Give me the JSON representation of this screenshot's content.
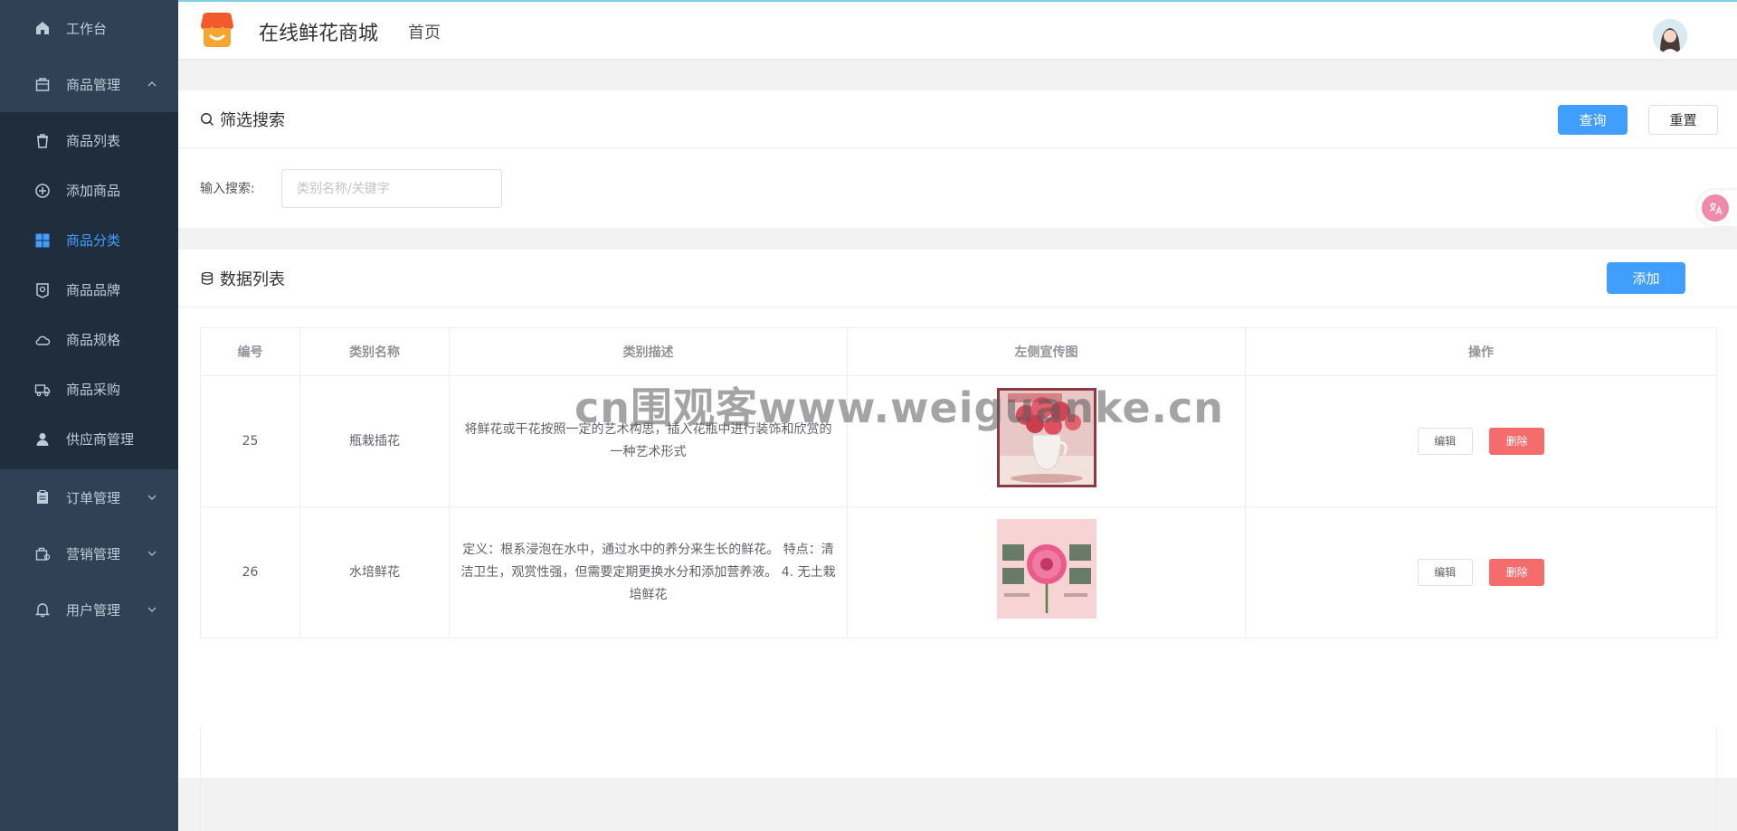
{
  "header": {
    "brand": "在线鲜花商城",
    "nav_home": "首页"
  },
  "sidebar": {
    "workbench": "工作台",
    "goods_management": "商品管理",
    "goods_sub": [
      {
        "label": "商品列表",
        "icon": "trash-bag-icon"
      },
      {
        "label": "添加商品",
        "icon": "plus-circle-icon"
      },
      {
        "label": "商品分类",
        "icon": "grid-icon",
        "active": true
      },
      {
        "label": "商品品牌",
        "icon": "tag-icon"
      },
      {
        "label": "商品规格",
        "icon": "cloud-icon"
      },
      {
        "label": "商品采购",
        "icon": "truck-icon"
      },
      {
        "label": "供应商管理",
        "icon": "user-icon"
      }
    ],
    "order_management": "订单管理",
    "marketing_management": "营销管理",
    "user_management": "用户管理"
  },
  "search": {
    "title": "筛选搜索",
    "query_button": "查询",
    "reset_button": "重置",
    "input_label": "输入搜索:",
    "placeholder": "类别名称/关键字"
  },
  "list": {
    "title": "数据列表",
    "add_button": "添加",
    "columns": [
      "编号",
      "类别名称",
      "类别描述",
      "左侧宣传图",
      "操作"
    ],
    "rows": [
      {
        "id": "25",
        "name": "瓶栽插花",
        "desc": "将鲜花或干花按照一定的艺术构思，插入花瓶中进行装饰和欣赏的一种艺术形式",
        "edit": "编辑",
        "delete": "删除"
      },
      {
        "id": "26",
        "name": "水培鲜花",
        "desc": "定义：根系浸泡在水中，通过水中的养分来生长的鲜花。 特点：清洁卫生，观赏性强，但需要定期更换水分和添加营养液。 4. 无土栽培鲜花",
        "edit": "编辑",
        "delete": "删除"
      }
    ]
  },
  "watermark": "cn围观客www.weiguanke.cn",
  "colors": {
    "sidebar_bg": "#304156",
    "submenu_bg": "#1f2d3d",
    "active": "#409eff",
    "danger": "#f56c6c"
  }
}
